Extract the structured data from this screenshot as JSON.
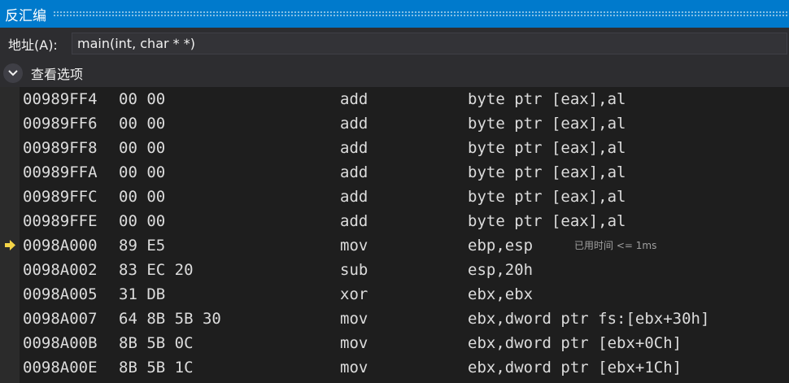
{
  "window": {
    "title": "反汇编"
  },
  "address": {
    "label": "地址(A):",
    "value": "main(int, char * *)"
  },
  "options": {
    "label": "查看选项"
  },
  "rows": [
    {
      "addr": "00989FF4",
      "bytes": "00 00",
      "op": "add",
      "args": "byte ptr [eax],al"
    },
    {
      "addr": "00989FF6",
      "bytes": "00 00",
      "op": "add",
      "args": "byte ptr [eax],al"
    },
    {
      "addr": "00989FF8",
      "bytes": "00 00",
      "op": "add",
      "args": "byte ptr [eax],al"
    },
    {
      "addr": "00989FFA",
      "bytes": "00 00",
      "op": "add",
      "args": "byte ptr [eax],al"
    },
    {
      "addr": "00989FFC",
      "bytes": "00 00",
      "op": "add",
      "args": "byte ptr [eax],al"
    },
    {
      "addr": "00989FFE",
      "bytes": "00 00",
      "op": "add",
      "args": "byte ptr [eax],al"
    },
    {
      "addr": "0098A000",
      "bytes": "89 E5",
      "op": "mov",
      "args": "ebp,esp",
      "current": true,
      "elapsed": "已用时间 <= 1ms"
    },
    {
      "addr": "0098A002",
      "bytes": "83 EC 20",
      "op": "sub",
      "args": "esp,20h"
    },
    {
      "addr": "0098A005",
      "bytes": "31 DB",
      "op": "xor",
      "args": "ebx,ebx"
    },
    {
      "addr": "0098A007",
      "bytes": "64 8B 5B 30",
      "op": "mov",
      "args": "ebx,dword ptr fs:[ebx+30h]"
    },
    {
      "addr": "0098A00B",
      "bytes": "8B 5B 0C",
      "op": "mov",
      "args": "ebx,dword ptr [ebx+0Ch]"
    },
    {
      "addr": "0098A00E",
      "bytes": "8B 5B 1C",
      "op": "mov",
      "args": "ebx,dword ptr [ebx+1Ch]"
    }
  ],
  "icons": {
    "current_instruction": "yellow-arrow-icon",
    "options_toggle": "chevron-down-icon"
  },
  "colors": {
    "titlebar": "#007acc",
    "background": "#1e1e1e",
    "toolbar": "#2d2d30",
    "code_text": "#dcdcdc",
    "current_arrow": "#f5d547"
  }
}
